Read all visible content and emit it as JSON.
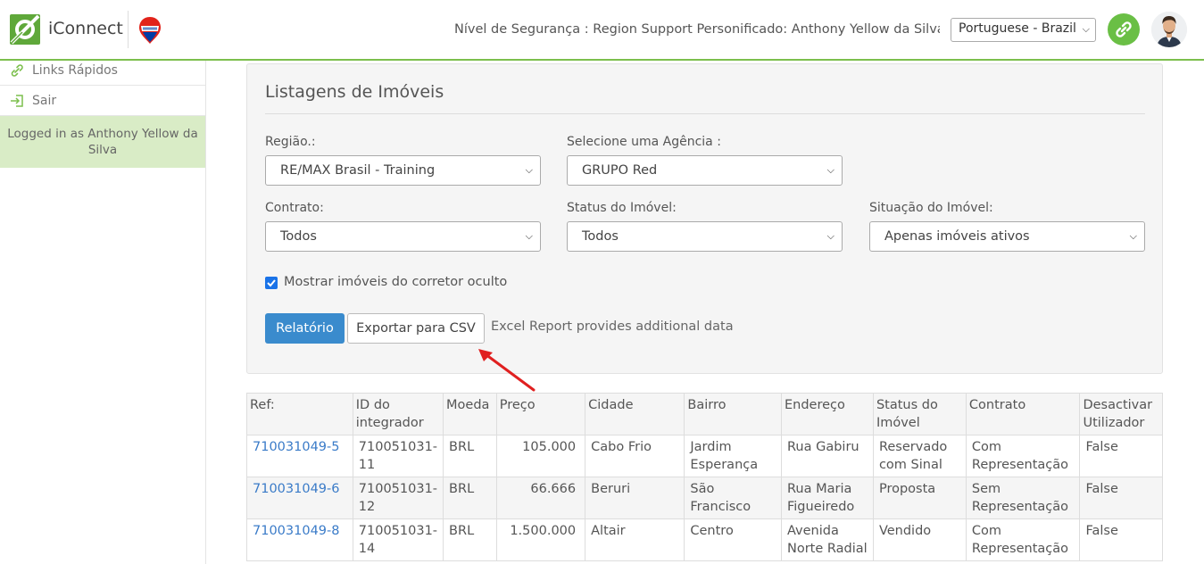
{
  "header": {
    "app_name": "iConnect",
    "security_info": "Nível de Segurança : Region Support  Personificado: Anthony Yellow da Silva (...",
    "language": "Portuguese - Brazil"
  },
  "sidebar": {
    "items": [
      {
        "label": "Links Rápidos",
        "icon": "link-icon"
      },
      {
        "label": "Sair",
        "icon": "logout-icon"
      }
    ],
    "logged_in": "Logged in as Anthony Yellow da Silva"
  },
  "panel": {
    "title": "Listagens de Imóveis",
    "regiao_label": "Região.:",
    "regiao_value": "RE/MAX Brasil - Training",
    "agencia_label": "Selecione uma Agência :",
    "agencia_value": "GRUPO Red",
    "contrato_label": "Contrato:",
    "contrato_value": "Todos",
    "status_label": "Status do Imóvel:",
    "status_value": "Todos",
    "situacao_label": "Situação do Imóvel:",
    "situacao_value": "Apenas imóveis ativos",
    "checkbox_label": "Mostrar imóveis do corretor oculto",
    "checkbox_checked": true,
    "report_button": "Relatório",
    "csv_button": "Exportar para CSV",
    "excel_note": "Excel Report provides additional data"
  },
  "table": {
    "headers": [
      "Ref:",
      "ID do integrador",
      "Moeda",
      "Preço",
      "Cidade",
      "Bairro",
      "Endereço",
      "Status do Imóvel",
      "Contrato",
      "Desactivar Utilizador"
    ],
    "rows": [
      [
        "710031049-5",
        "710051031-11",
        "BRL",
        "105.000",
        "Cabo Frio",
        "Jardim Esperança",
        "Rua Gabiru",
        "Reservado com Sinal",
        "Com Representação",
        "False"
      ],
      [
        "710031049-6",
        "710051031-12",
        "BRL",
        "66.666",
        "Beruri",
        "São Francisco",
        "Rua Maria Figueiredo",
        "Proposta",
        "Sem Representação",
        "False"
      ],
      [
        "710031049-8",
        "710051031-14",
        "BRL",
        "1.500.000",
        "Altair",
        "Centro",
        "Avenida Norte Radial",
        "Vendido",
        "Com Representação",
        "False"
      ]
    ]
  },
  "colors": {
    "brand_green": "#6abf45",
    "primary_blue": "#3a8bcd",
    "link_blue": "#3a7bc8",
    "arrow_red": "#e02020"
  }
}
